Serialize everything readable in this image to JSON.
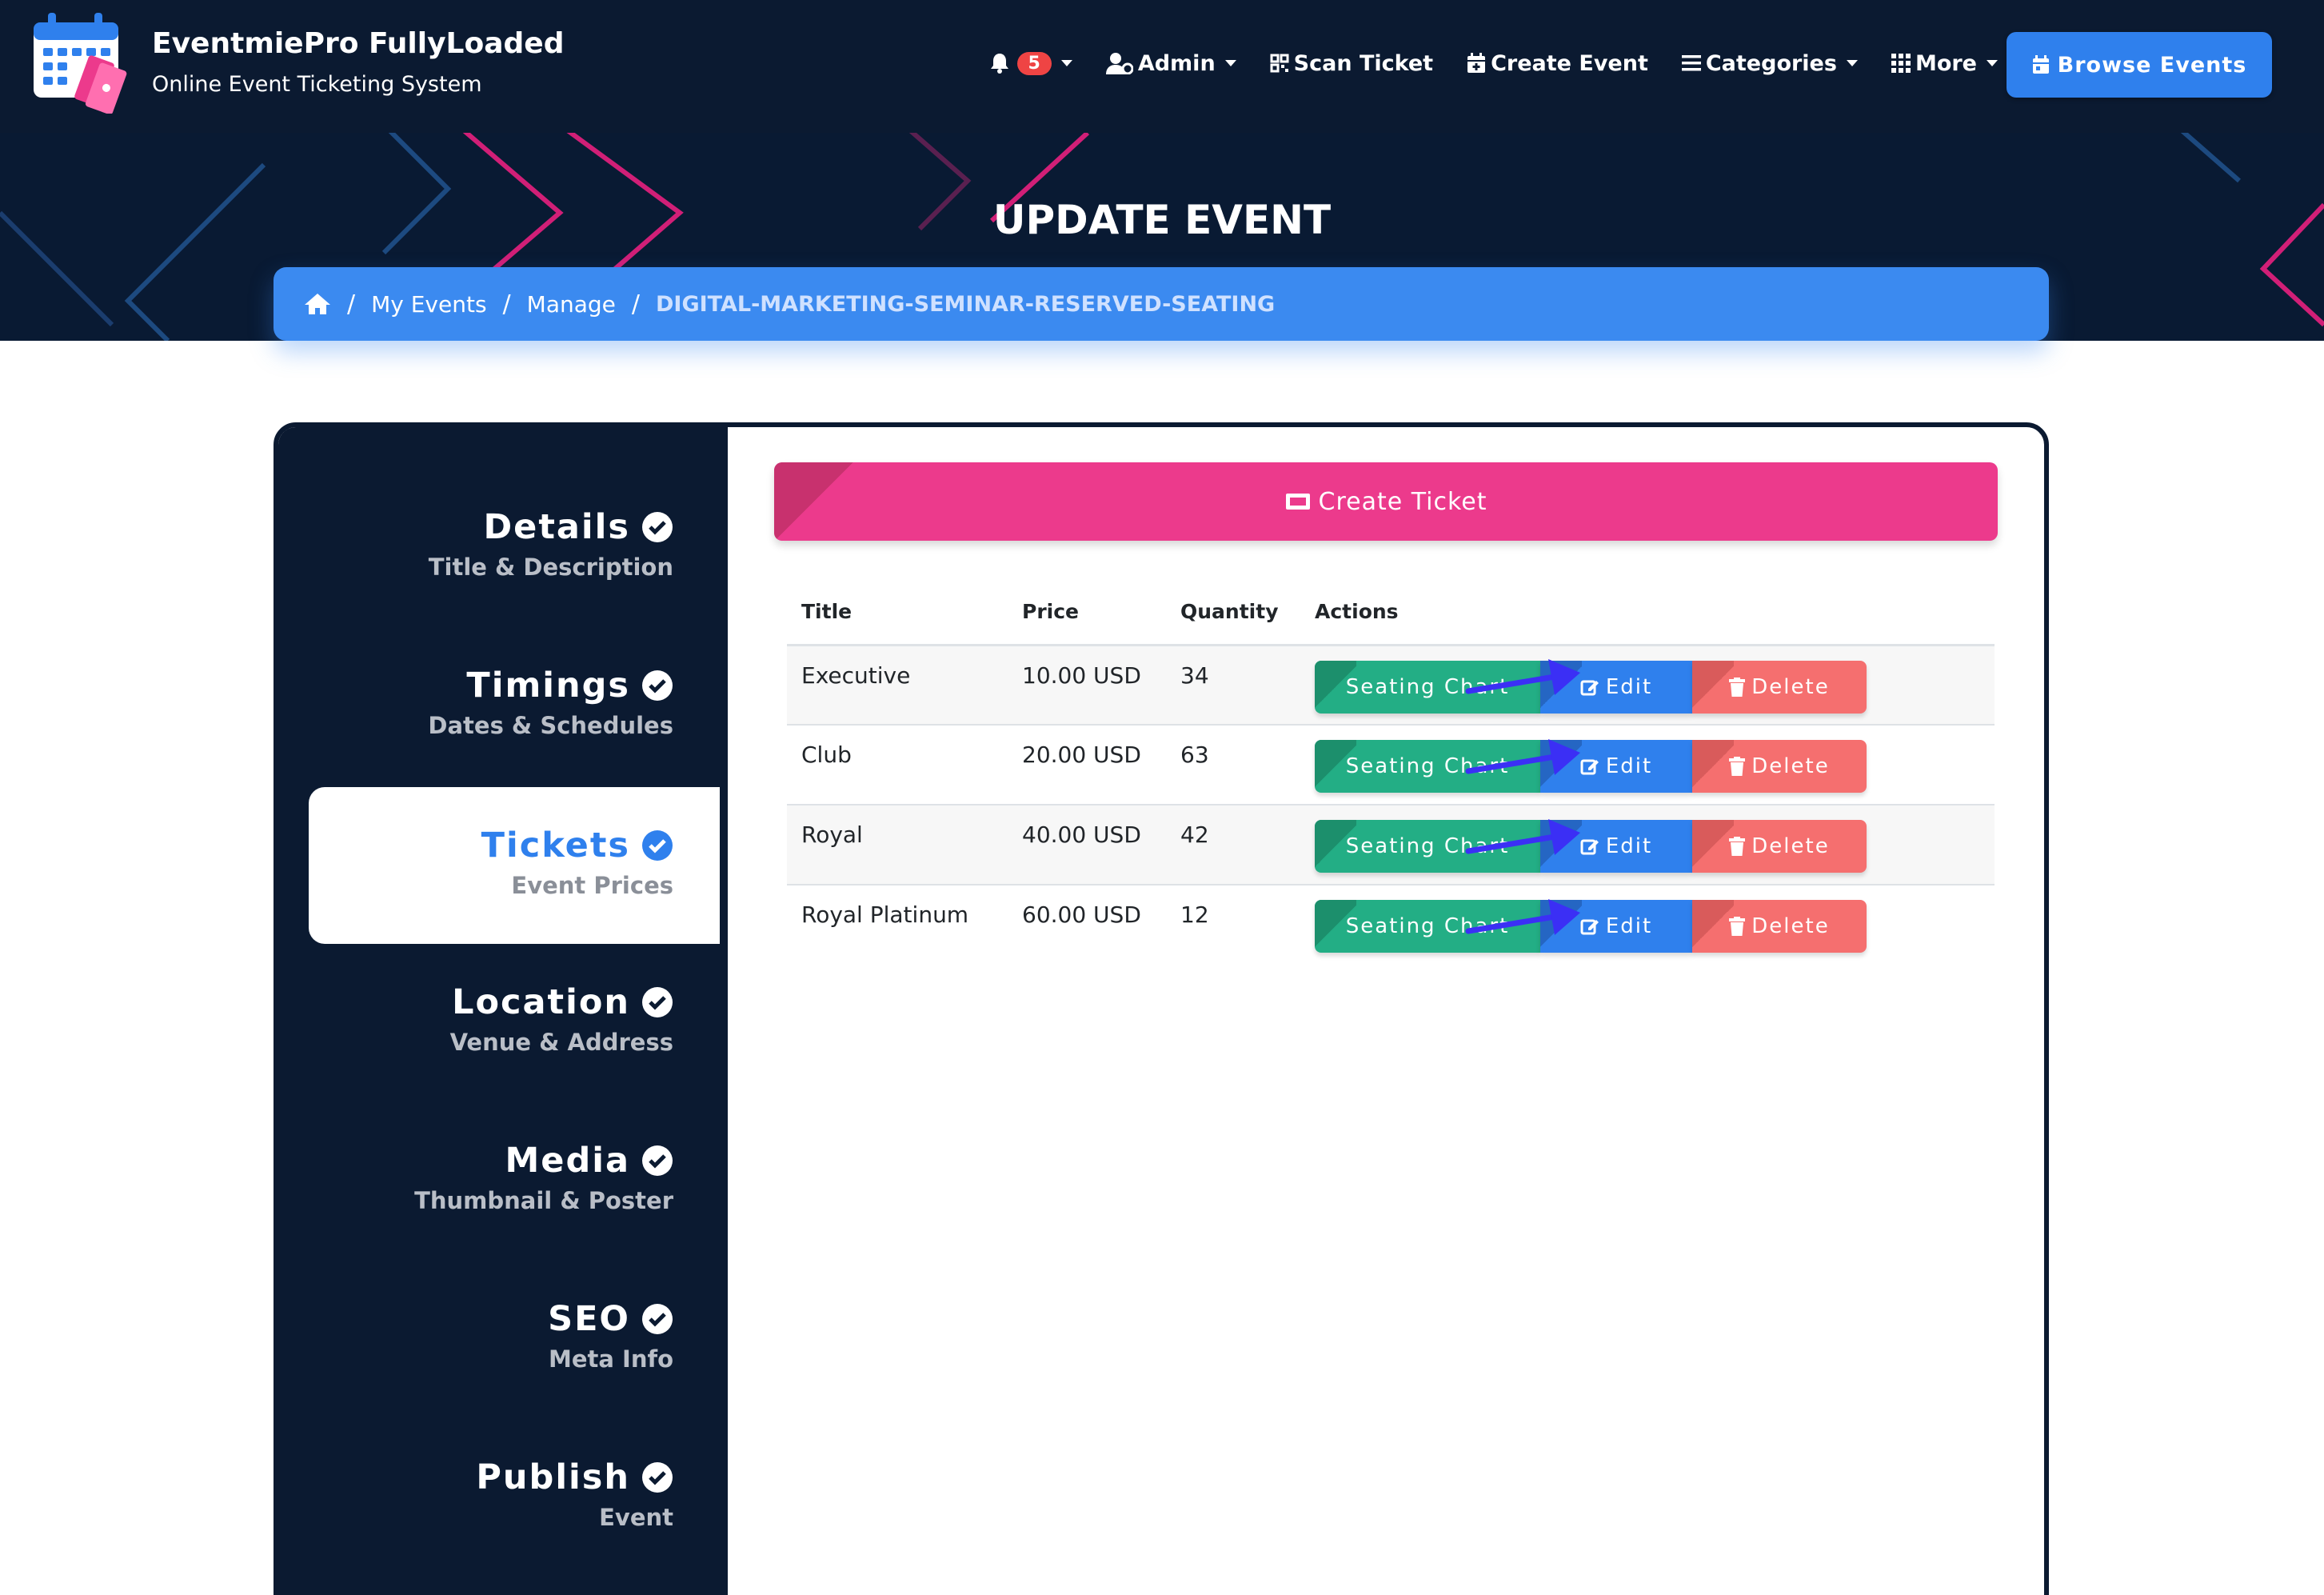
{
  "colors": {
    "navbar_bg": "#0b1a31",
    "accent_blue": "#2f80ed",
    "pink": "#ec3a8c",
    "green": "#23ae85",
    "red": "#f56f6f",
    "arrow": "#3b2ff5"
  },
  "brand": {
    "title": "EventmiePro FullyLoaded",
    "subtitle": "Online Event Ticketing System"
  },
  "nav": {
    "notification_count": "5",
    "admin": "Admin",
    "scan_ticket": "Scan Ticket",
    "create_event": "Create Event",
    "categories": "Categories",
    "more": "More",
    "browse_events": "Browse Events"
  },
  "page": {
    "title": "UPDATE EVENT"
  },
  "breadcrumb": {
    "my_events": "My Events",
    "manage": "Manage",
    "current": "DIGITAL-MARKETING-SEMINAR-RESERVED-SEATING"
  },
  "steps": [
    {
      "title": "Details",
      "subtitle": "Title & Description"
    },
    {
      "title": "Timings",
      "subtitle": "Dates & Schedules"
    },
    {
      "title": "Tickets",
      "subtitle": "Event Prices"
    },
    {
      "title": "Location",
      "subtitle": "Venue & Address"
    },
    {
      "title": "Media",
      "subtitle": "Thumbnail & Poster"
    },
    {
      "title": "SEO",
      "subtitle": "Meta Info"
    },
    {
      "title": "Publish",
      "subtitle": "Event"
    }
  ],
  "create_ticket_label": "Create Ticket",
  "table": {
    "headers": {
      "title": "Title",
      "price": "Price",
      "quantity": "Quantity",
      "actions": "Actions"
    },
    "rows": [
      {
        "title": "Executive",
        "price": "10.00 USD",
        "quantity": "34"
      },
      {
        "title": "Club",
        "price": "20.00 USD",
        "quantity": "63"
      },
      {
        "title": "Royal",
        "price": "40.00 USD",
        "quantity": "42"
      },
      {
        "title": "Royal Platinum",
        "price": "60.00 USD",
        "quantity": "12"
      }
    ],
    "actions": {
      "seating_chart": "Seating Chart",
      "edit": "Edit",
      "delete": "Delete"
    }
  }
}
